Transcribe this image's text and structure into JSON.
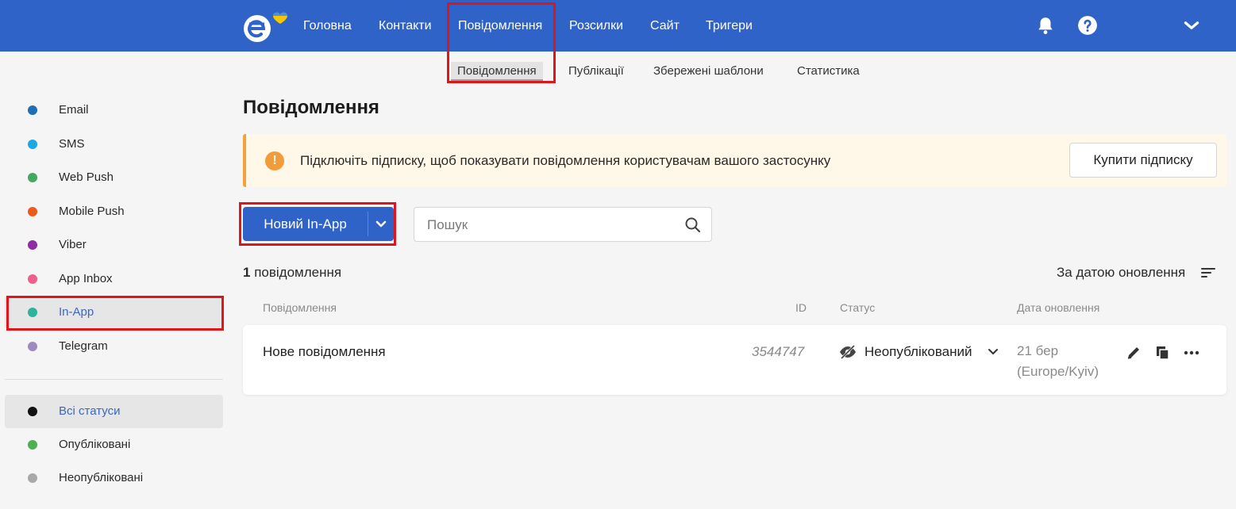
{
  "colors": {
    "brand": "#2f63c8",
    "highlight": "#e0141b",
    "warning": "#f29b3a",
    "banner_bg": "#fff7e8"
  },
  "topnav": {
    "items": [
      "Головна",
      "Контакти",
      "Повідомлення",
      "Розсилки",
      "Сайт",
      "Тригери"
    ],
    "active": "Повідомлення",
    "icons": [
      "bell-icon",
      "help-icon",
      "chevron-down-icon"
    ]
  },
  "subnav": {
    "items": [
      "Повідомлення",
      "Публікації",
      "Збережені шаблони",
      "Статистика"
    ],
    "active": "Повідомлення"
  },
  "sidebar": {
    "channels": [
      {
        "label": "Email",
        "color": "#1e6fb4"
      },
      {
        "label": "SMS",
        "color": "#1aa9e4"
      },
      {
        "label": "Web Push",
        "color": "#45a861"
      },
      {
        "label": "Mobile Push",
        "color": "#ee5a1d"
      },
      {
        "label": "Viber",
        "color": "#8e2ba5"
      },
      {
        "label": "App Inbox",
        "color": "#ee5f8b"
      },
      {
        "label": "In-App",
        "color": "#2bb39b"
      },
      {
        "label": "Telegram",
        "color": "#9d8bbf"
      }
    ],
    "active_channel": "In-App",
    "statuses": [
      {
        "label": "Всі статуси",
        "color": "#111111"
      },
      {
        "label": "Опубліковані",
        "color": "#4caf50"
      },
      {
        "label": "Неопубліковані",
        "color": "#a8a8a8"
      }
    ],
    "active_status": "Всі статуси"
  },
  "main": {
    "title": "Повідомлення",
    "banner": {
      "icon": "!",
      "text": "Підключіть підписку, щоб показувати повідомлення користувачам вашого застосунку",
      "button": "Купити підписку"
    },
    "new_button": "Новий In-App",
    "search": {
      "placeholder": "Пошук",
      "value": ""
    },
    "count": {
      "number": "1",
      "label": "повідомлення"
    },
    "sort_label": "За датою оновлення",
    "columns": [
      "Повідомлення",
      "ID",
      "Статус",
      "Дата оновлення"
    ],
    "rows": [
      {
        "name": "Нове повідомлення",
        "id": "3544747",
        "status": "Неопублікований",
        "date_line1": "21 бер",
        "date_line2": "(Europe/Kyiv)"
      }
    ]
  }
}
